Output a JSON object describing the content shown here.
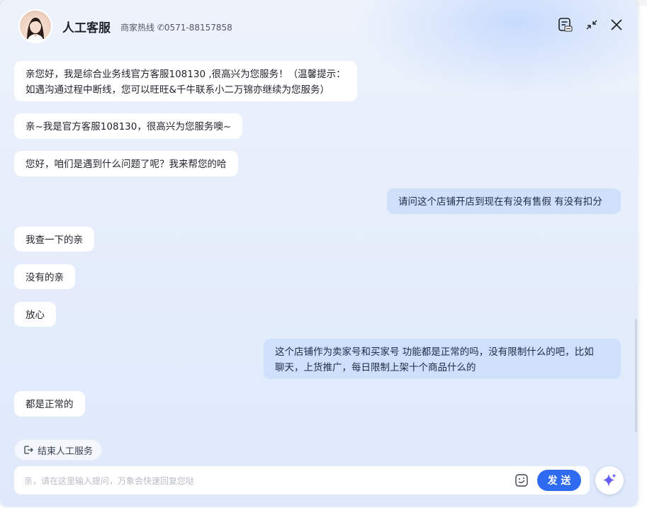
{
  "header": {
    "agent_name": "人工客服",
    "hotline": "商家热线 ✆0571-88157858"
  },
  "messages": [
    {
      "side": "agent",
      "lines": [
        "亲您好，我是综合业务线官方客服108130 ,很高兴为您服务！（温馨提示：",
        "如遇沟通过程中断线，您可以旺旺&千牛联系小二万锦亦继续为您服务）"
      ]
    },
    {
      "side": "agent",
      "lines": [
        "亲~我是官方客服108130，很高兴为您服务噢~"
      ]
    },
    {
      "side": "agent",
      "lines": [
        "您好，咱们是遇到什么问题了呢？我来帮您的哈"
      ]
    },
    {
      "side": "user",
      "lines": [
        "请问这个店铺开店到现在有没有售假 有没有扣分"
      ]
    },
    {
      "side": "agent",
      "lines": [
        "我查一下的亲"
      ]
    },
    {
      "side": "agent",
      "lines": [
        "没有的亲"
      ]
    },
    {
      "side": "agent",
      "lines": [
        "放心"
      ]
    },
    {
      "side": "user",
      "lines": [
        "这个店铺作为卖家号和买家号 功能都是正常的吗，没有限制什么的吧，比如",
        "聊天，上货推广，每日限制上架十个商品什么的"
      ]
    },
    {
      "side": "agent",
      "lines": [
        "都是正常的"
      ]
    }
  ],
  "footer": {
    "end_service_label": "结束人工服务",
    "input_placeholder": "亲，请在这里输入提问，万象会快速回复您哒",
    "send_label": "发 送"
  },
  "icons": {
    "avatar": "agent-avatar",
    "history": "chat-history-icon",
    "minimize": "shrink-icon",
    "close": "close-icon",
    "end_service": "logout-icon",
    "emoji": "sticker-icon",
    "ai": "ai-sparkle-icon"
  },
  "colors": {
    "accent": "#2f6bf0",
    "user_bubble": "#cfe0fb",
    "agent_bubble": "#ffffff"
  }
}
